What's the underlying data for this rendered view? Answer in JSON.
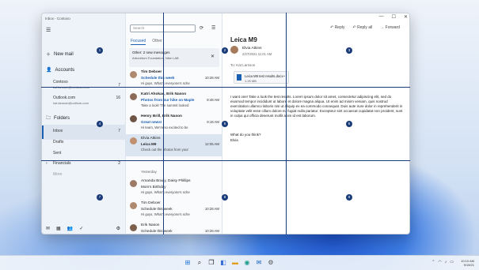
{
  "window": {
    "title": "Inbox - Contoso",
    "controls": [
      "—",
      "☐",
      "✕"
    ]
  },
  "nav": {
    "new_mail": "New mail",
    "accounts_label": "Accounts",
    "accounts": [
      {
        "name": "Contoso",
        "email": "kat.larsson@contoso.com"
      },
      {
        "name": "Outlook.com",
        "email": "kat.larsson@outlook.com",
        "count": "16"
      }
    ],
    "accounts_count": "7",
    "folders_label": "Folders",
    "folders": [
      {
        "name": "Inbox",
        "count": "7"
      },
      {
        "name": "Drafts",
        "count": ""
      },
      {
        "name": "Sent",
        "count": ""
      },
      {
        "name": "Financials",
        "count": "2"
      },
      {
        "name": "More",
        "count": ""
      }
    ]
  },
  "list": {
    "search_placeholder": "Search",
    "tabs": [
      "Focused",
      "Other"
    ],
    "notice": {
      "title": "Other: 2 new messages",
      "detail": "Arboretum Foundation, Nike LAB"
    },
    "messages": [
      {
        "sender": "Tim Deboer",
        "subject": "Schedule this week",
        "preview": "Hi guys, What's everyone's sche",
        "time": "10:28 AM"
      },
      {
        "sender": "Katri Ahokas, Erik Nason",
        "subject": "Photos from our hike on Maple",
        "preview": "Take a look! The summit looked",
        "time": "8:48 AM"
      },
      {
        "sender": "Henry Brill, Erik Nason",
        "subject": "Great news!",
        "preview": "Hi team, We're so excited to be",
        "time": "9:18 AM"
      },
      {
        "sender": "Elvia Atkins",
        "subject": "Leica M9",
        "preview": "Check out the photos from your",
        "time": "12:05 AM"
      }
    ],
    "yesterday_label": "Yesterday",
    "older": [
      {
        "sender": "Amanda Brady, Daisy Phillips",
        "subject": "Mom's Birthday",
        "preview": "Hi guys, What's everyone's sche",
        "time": ""
      },
      {
        "sender": "Tim Deboer",
        "subject": "Schedule this week",
        "preview": "Hi guys, What's everyone's sche",
        "time": "10:28 AM"
      },
      {
        "sender": "Erik Nason",
        "subject": "Schedule this week",
        "preview": "Hi guys, What's everyone's sche",
        "time": "10:28 AM"
      }
    ]
  },
  "pane": {
    "toolbar": {
      "reply": "Reply",
      "reply_all": "Reply all",
      "forward": "Forward"
    },
    "subject": "Leica M9",
    "from_name": "Elvia Atkins",
    "from_date": "2/27/2021 11:01 AM",
    "to_label": "To:",
    "to_name": "Kat Larsson",
    "attachment": {
      "name": "Leica M9 test results.docx",
      "size": "1.25 MB"
    },
    "body": "I want one! Take a look the test results. Lorem ipsum dolor sit amet, consectetur adipiscing elit, sed do eiusmod tempor incididunt ut labore et dolore magna aliqua. Ut enim ad minim veniam, quis nostrud exercitation ullamco laboris nisi ut aliquip ex ea commodo consequat. Duis aute irure dolor in reprehenderit in voluptate velit esse cillum dolore eu fugiat nulla pariatur. Excepteur sint occaecat cupidatat non proident, sunt in culpa qui officia deserunt mollit anim id est laborum.",
    "question": "What do you think?",
    "signature": "Elvia"
  },
  "grid_labels": [
    "1",
    "2",
    "3",
    "4",
    "5",
    "6",
    "7",
    "8",
    "9"
  ],
  "taskbar": {
    "clock_time": "10:10 AM",
    "clock_date": "9/15/21"
  }
}
